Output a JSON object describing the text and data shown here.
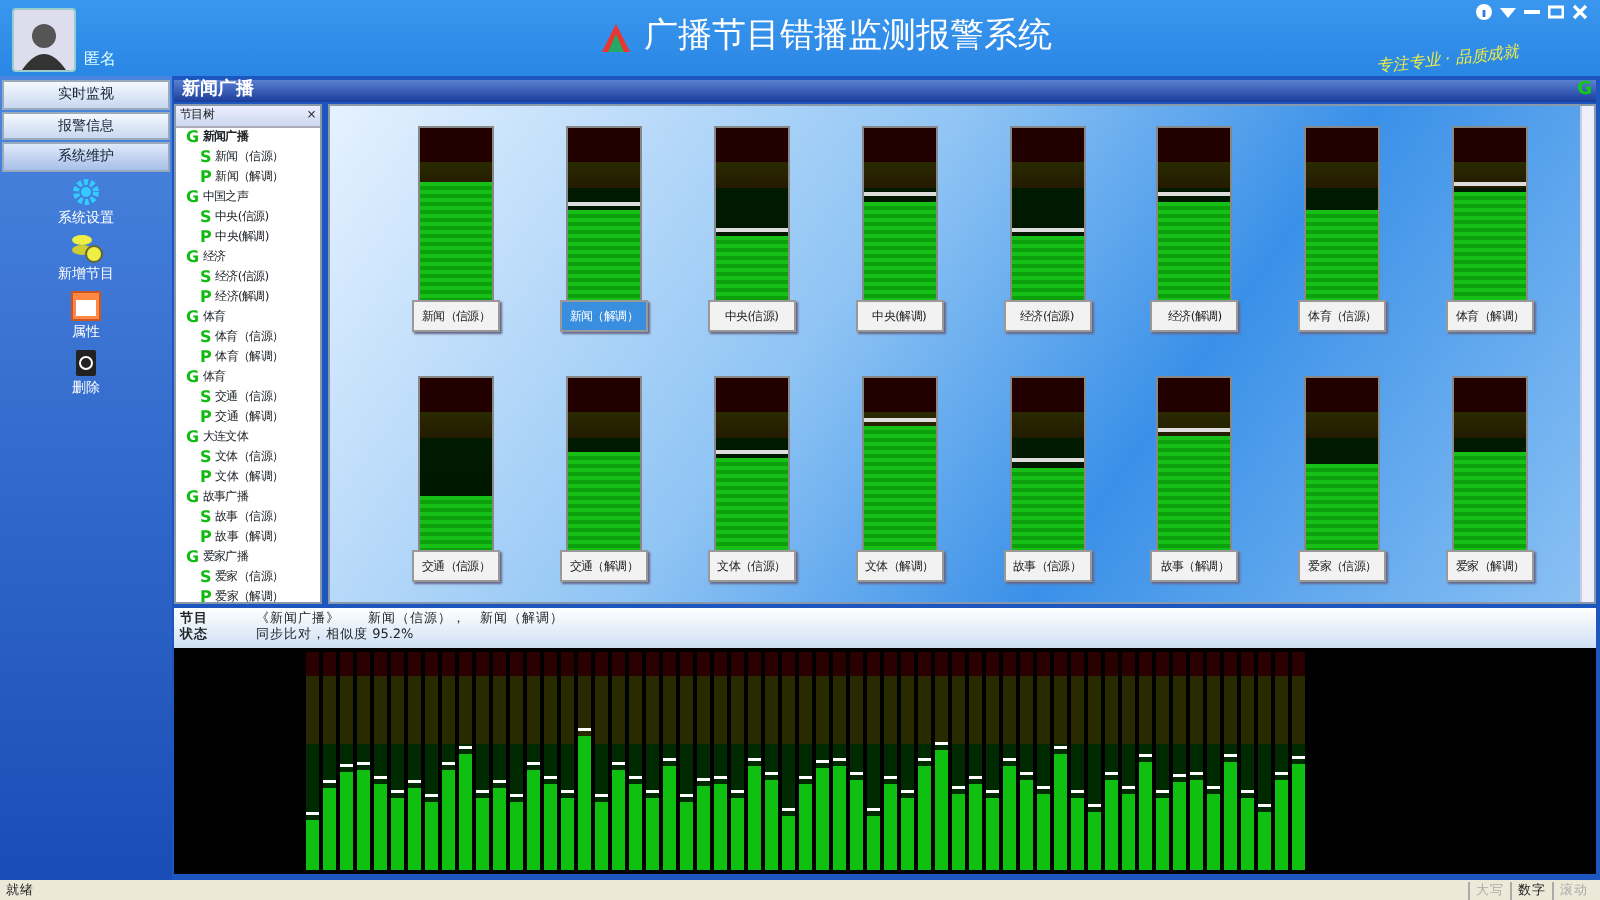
{
  "header": {
    "title": "广播节目错播监测报警系统",
    "user": "匿名",
    "slogan": "专注专业 · 品质成就"
  },
  "nav": [
    {
      "label": "实时监视",
      "selected": false
    },
    {
      "label": "报警信息",
      "selected": false
    },
    {
      "label": "系统维护",
      "selected": true
    }
  ],
  "tools": [
    {
      "kind": "gear",
      "label": "系统设置"
    },
    {
      "kind": "add",
      "label": "新增节目"
    },
    {
      "kind": "props",
      "label": "属性"
    },
    {
      "kind": "delete",
      "label": "删除"
    }
  ],
  "panel": {
    "title": "新闻广播",
    "badge": "G"
  },
  "tree": {
    "title": "节目树",
    "close": "×",
    "groups": [
      {
        "tag": "G",
        "label": "新闻广播",
        "bold": true,
        "children": [
          {
            "tag": "S",
            "label": "新闻（信源）"
          },
          {
            "tag": "P",
            "label": "新闻（解调）"
          }
        ]
      },
      {
        "tag": "G",
        "label": "中国之声",
        "bold": false,
        "children": [
          {
            "tag": "S",
            "label": "中央(信源)"
          },
          {
            "tag": "P",
            "label": "中央(解调)"
          }
        ]
      },
      {
        "tag": "G",
        "label": "经济",
        "bold": false,
        "children": [
          {
            "tag": "S",
            "label": "经济(信源)"
          },
          {
            "tag": "P",
            "label": "经济(解调)"
          }
        ]
      },
      {
        "tag": "G",
        "label": "体育",
        "bold": false,
        "children": [
          {
            "tag": "S",
            "label": "体育（信源）"
          },
          {
            "tag": "P",
            "label": "体育（解调）"
          }
        ]
      },
      {
        "tag": "G",
        "label": "体育",
        "bold": false,
        "children": [
          {
            "tag": "S",
            "label": "交通（信源）"
          },
          {
            "tag": "P",
            "label": "交通（解调）"
          }
        ]
      },
      {
        "tag": "G",
        "label": "大连文体",
        "bold": false,
        "children": [
          {
            "tag": "S",
            "label": "文体（信源）"
          },
          {
            "tag": "P",
            "label": "文体（解调）"
          }
        ]
      },
      {
        "tag": "G",
        "label": "故事广播",
        "bold": false,
        "children": [
          {
            "tag": "S",
            "label": "故事（信源）"
          },
          {
            "tag": "P",
            "label": "故事（解调）"
          }
        ]
      },
      {
        "tag": "G",
        "label": "爱家广播",
        "bold": false,
        "children": [
          {
            "tag": "S",
            "label": "爱家（信源）"
          },
          {
            "tag": "P",
            "label": "爱家（解调）"
          }
        ]
      }
    ]
  },
  "meters": [
    {
      "label": "新闻（信源）",
      "level": 0.69,
      "peak": false,
      "selected": false
    },
    {
      "label": "新闻（解调）",
      "level": 0.52,
      "peak": true,
      "selected": true
    },
    {
      "label": "中央(信源)",
      "level": 0.37,
      "peak": true,
      "selected": false
    },
    {
      "label": "中央(解调)",
      "level": 0.57,
      "peak": true,
      "selected": false
    },
    {
      "label": "经济(信源)",
      "level": 0.37,
      "peak": true,
      "selected": false
    },
    {
      "label": "经济(解调)",
      "level": 0.57,
      "peak": true,
      "selected": false
    },
    {
      "label": "体育（信源）",
      "level": 0.52,
      "peak": false,
      "selected": false
    },
    {
      "label": "体育（解调）",
      "level": 0.63,
      "peak": true,
      "selected": false
    },
    {
      "label": "交通（信源）",
      "level": 0.31,
      "peak": false,
      "selected": false
    },
    {
      "label": "交通（解调）",
      "level": 0.57,
      "peak": false,
      "selected": false
    },
    {
      "label": "文体（信源）",
      "level": 0.53,
      "peak": true,
      "selected": false
    },
    {
      "label": "文体（解调）",
      "level": 0.72,
      "peak": true,
      "selected": false
    },
    {
      "label": "故事（信源）",
      "level": 0.48,
      "peak": true,
      "selected": false
    },
    {
      "label": "故事（解调）",
      "level": 0.66,
      "peak": true,
      "selected": false
    },
    {
      "label": "爱家（信源）",
      "level": 0.5,
      "peak": false,
      "selected": false
    },
    {
      "label": "爱家（解调）",
      "level": 0.57,
      "peak": false,
      "selected": false
    }
  ],
  "info": {
    "program_label": "节目",
    "program_value": "《新闻广播》　　新闻（信源），　新闻（解调）",
    "status_label": "状态",
    "status_value": "同步比对，相似度 95.2%"
  },
  "status_bar": {
    "text": "就绪",
    "indicators": [
      {
        "label": "大写",
        "on": false
      },
      {
        "label": "数字",
        "on": true
      },
      {
        "label": "滚动",
        "on": false
      }
    ]
  }
}
